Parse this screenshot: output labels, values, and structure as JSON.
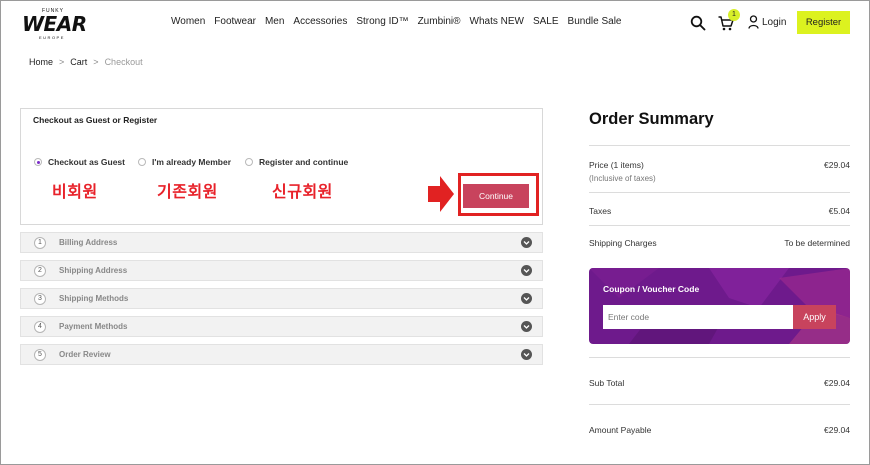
{
  "header": {
    "logo_top": "FUNKY",
    "logo_main": "WEAR",
    "logo_sub": "EUROPE",
    "nav": [
      {
        "label": "Women"
      },
      {
        "label": "Footwear"
      },
      {
        "label": "Men"
      },
      {
        "label": "Accessories"
      },
      {
        "label": "Strong ID™"
      },
      {
        "label": "Zumbini®"
      },
      {
        "label": "Whats NEW"
      },
      {
        "label": "SALE"
      },
      {
        "label": "Bundle Sale"
      }
    ],
    "cart_count": "1",
    "login_label": "Login",
    "register_label": "Register",
    "accent_color": "#dcf21f"
  },
  "breadcrumb": {
    "home": "Home",
    "cart": "Cart",
    "current": "Checkout",
    "separator": ">"
  },
  "checkout": {
    "title": "Checkout as Guest or Register",
    "options": [
      {
        "label": "Checkout as Guest",
        "selected": true,
        "annotation": "비회원"
      },
      {
        "label": "I'm already Member",
        "selected": false,
        "annotation": "기존회원"
      },
      {
        "label": "Register and continue",
        "selected": false,
        "annotation": "신규회원"
      }
    ],
    "continue_label": "Continue",
    "annotation_color": "#e8222a"
  },
  "steps": [
    {
      "num": "1",
      "label": "Billing Address"
    },
    {
      "num": "2",
      "label": "Shipping Address"
    },
    {
      "num": "3",
      "label": "Shipping Methods"
    },
    {
      "num": "4",
      "label": "Payment Methods"
    },
    {
      "num": "5",
      "label": "Order Review"
    }
  ],
  "summary": {
    "title": "Order Summary",
    "price_label": "Price (1 items)",
    "price_note": "(Inclusive of taxes)",
    "price_value": "€29.04",
    "taxes_label": "Taxes",
    "taxes_value": "€5.04",
    "shipping_label": "Shipping Charges",
    "shipping_value": "To be determined",
    "coupon_title": "Coupon / Voucher Code",
    "coupon_placeholder": "Enter code",
    "apply_label": "Apply",
    "subtotal_label": "Sub Total",
    "subtotal_value": "€29.04",
    "payable_label": "Amount Payable",
    "payable_value": "€29.04",
    "button_color": "#c8435d",
    "coupon_bg_color": "#6e1a8c"
  }
}
